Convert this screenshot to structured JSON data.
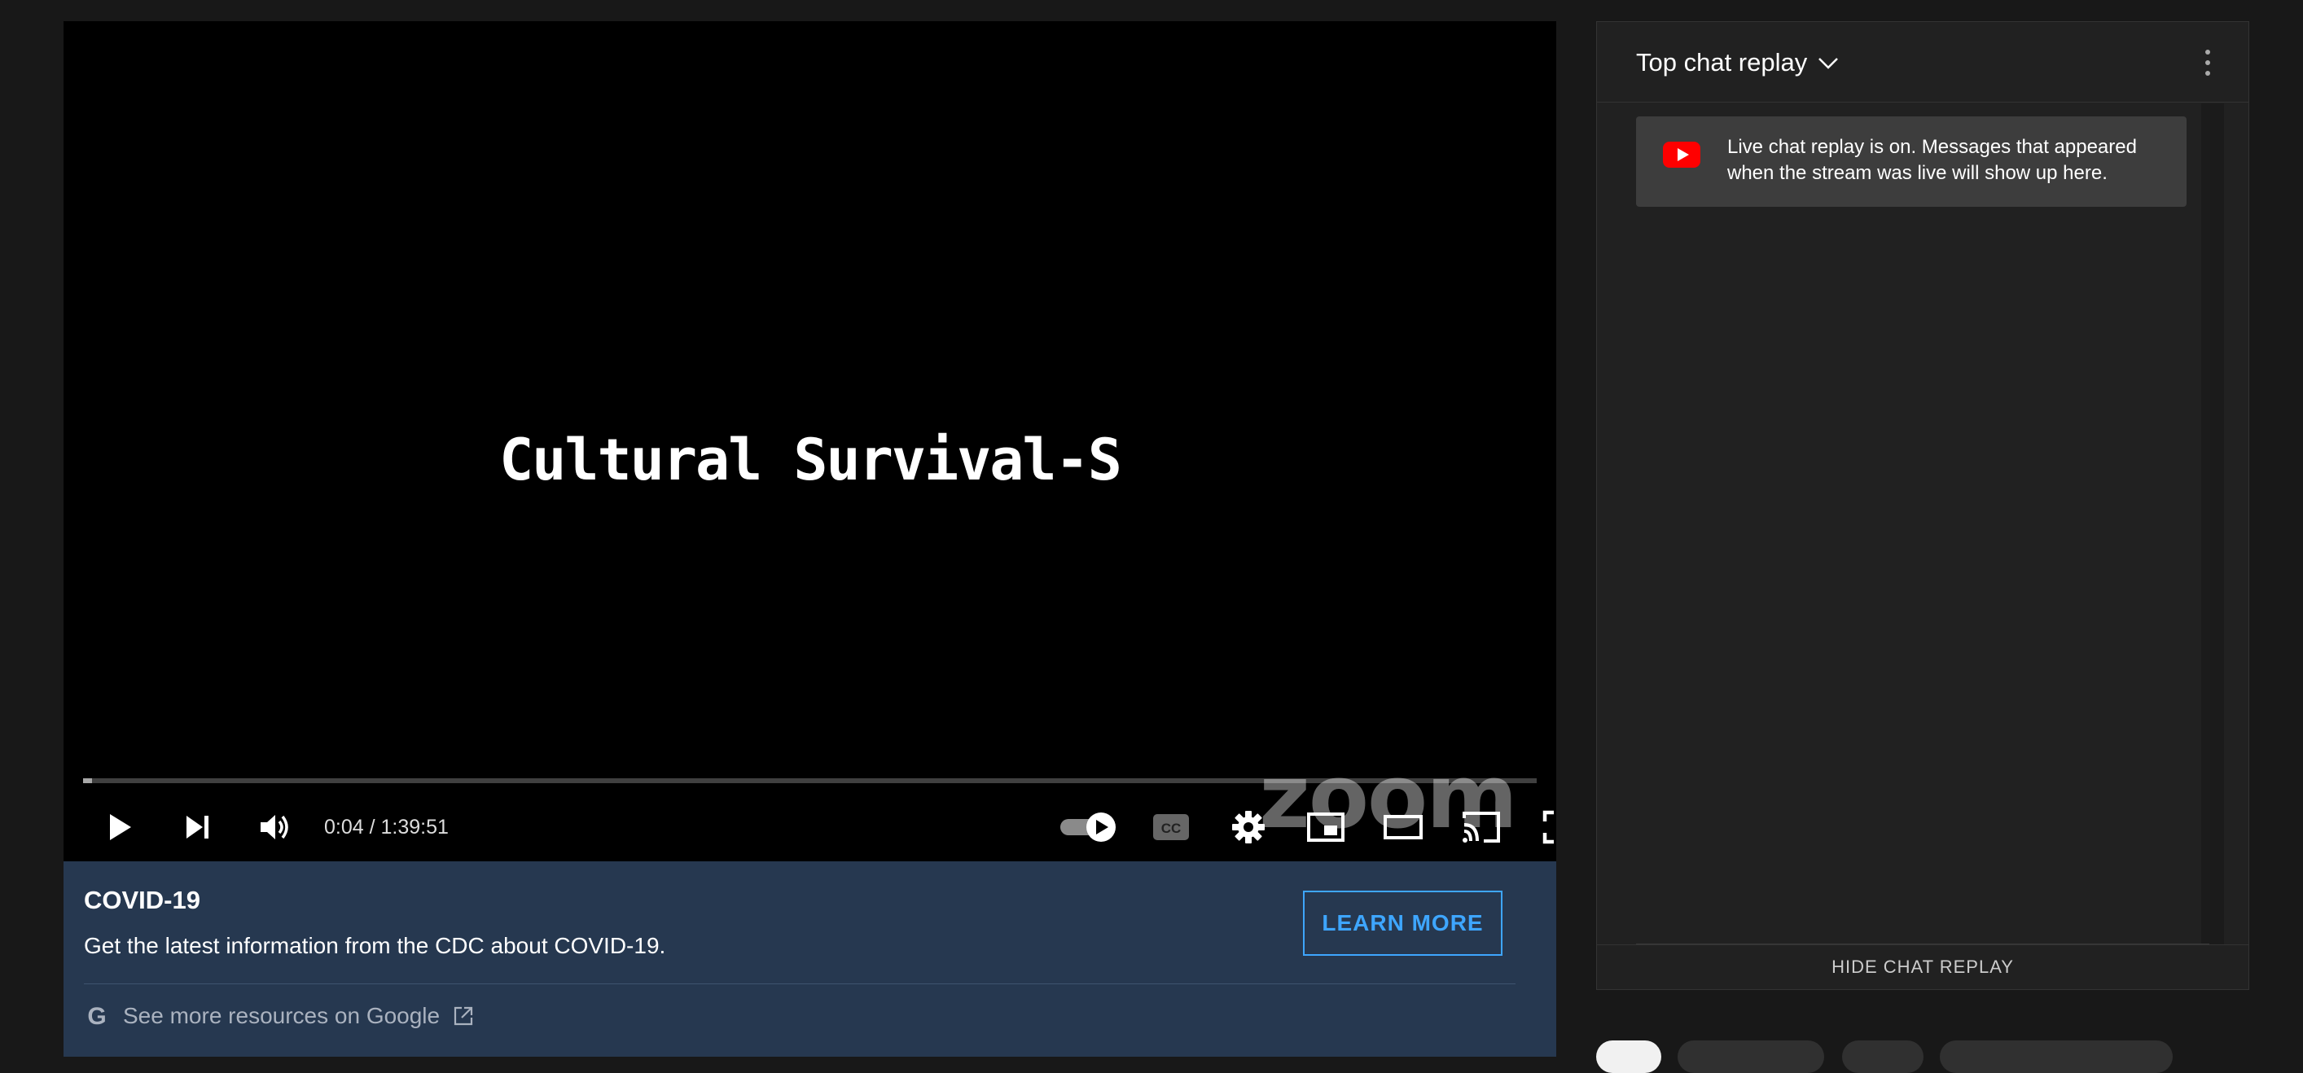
{
  "player": {
    "video_title": "Cultural Survival-S",
    "watermark": "zoom",
    "progress_fraction": 0.006,
    "time_display": "0:04 / 1:39:51"
  },
  "controls": {
    "play_icon": "play-icon",
    "next_icon": "next-icon",
    "volume_icon": "volume-icon",
    "autoplay_icon": "autoplay-toggle-icon",
    "cc_label": "CC",
    "settings_icon": "gear-icon",
    "miniplayer_icon": "miniplayer-icon",
    "theater_icon": "theater-mode-icon",
    "cast_icon": "cast-icon",
    "fullscreen_icon": "fullscreen-icon"
  },
  "info_panel": {
    "title": "COVID-19",
    "description": "Get the latest information from the CDC about COVID-19.",
    "button_label": "LEARN MORE",
    "link_text": "See more resources on Google",
    "google_letter": "G"
  },
  "chat": {
    "mode_label": "Top chat replay",
    "notice": "Live chat replay is on. Messages that appeared when the stream was live will show up here.",
    "hide_label": "HIDE CHAT REPLAY"
  },
  "colors": {
    "accent": "#3ea6ff",
    "banner": "#263850",
    "youtube_red": "#ff0000"
  }
}
